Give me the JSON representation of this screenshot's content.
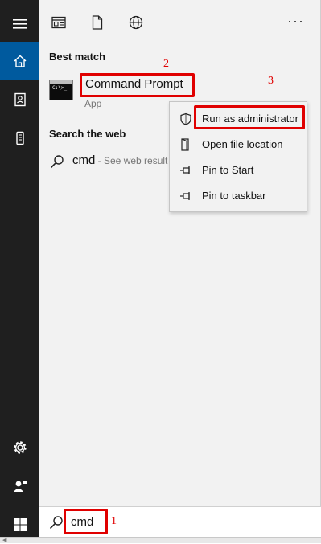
{
  "top_icons": [
    "dashboard-icon",
    "document-icon",
    "globe-icon"
  ],
  "more_label": "···",
  "rail": {
    "items": [
      "menu-icon",
      "home-icon",
      "notebook-icon",
      "device-icon",
      "settings-icon",
      "user-icon"
    ]
  },
  "best_match": {
    "heading": "Best match",
    "icon_text": "C:\\>_",
    "name": "Command Prompt",
    "type": "App"
  },
  "web": {
    "heading": "Search the web",
    "query": "cmd",
    "hint": " - See web result"
  },
  "context_menu": {
    "items": [
      {
        "label": "Run as administrator",
        "icon": "shield-icon"
      },
      {
        "label": "Open file location",
        "icon": "file-location-icon"
      },
      {
        "label": "Pin to Start",
        "icon": "pin-icon"
      },
      {
        "label": "Pin to taskbar",
        "icon": "pin-icon"
      }
    ]
  },
  "search": {
    "value": "cmd"
  },
  "annotations": {
    "step1": "1",
    "step2": "2",
    "step3": "3"
  },
  "colors": {
    "rail": "#1f1f1f",
    "rail_active": "#005a9e",
    "annotation": "#e00000",
    "panel": "#f2f2f2"
  }
}
